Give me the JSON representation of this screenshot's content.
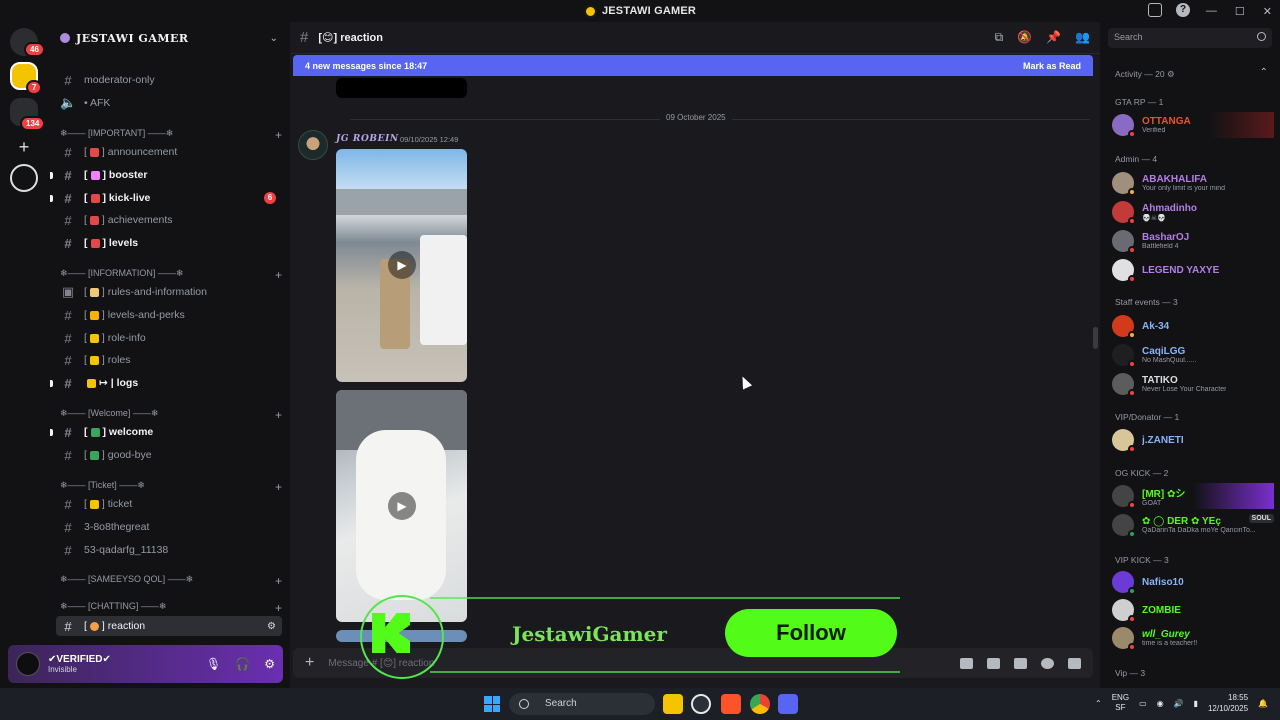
{
  "titlebar": {
    "title": "JESTAWI GAMER",
    "min": "—",
    "max": "☐",
    "close": "✕"
  },
  "rail": {
    "dm_badge": "46",
    "server_badge": "7",
    "folder_badge": "134"
  },
  "sidebar": {
    "guild_name": "JESTAWI GAMER",
    "channels_top": [
      {
        "label": "moderator-only"
      },
      {
        "label": "• AFK"
      }
    ],
    "categories": {
      "important": "❄—— [IMPORTANT] ——❄",
      "information": "❄—— [INFORMATION] ——❄",
      "welcome": "❄—— [Welcome] ——❄",
      "ticket": "❄—— [Ticket] ——❄",
      "sameeyso": "❄—— [SAMEEYSO QOL] ——❄",
      "chatting": "❄—— [CHATTING] ——❄"
    },
    "channels": {
      "announcement": "announcement",
      "booster": "booster",
      "kick_live": "kick-live",
      "kick_live_mentions": "6",
      "achievements": "achievements",
      "levels": "levels",
      "rules": "rules-and-information",
      "levels_perks": "levels-and-perks",
      "role_info": "role-info",
      "roles": "roles",
      "logs": "logs",
      "welcome": "welcome",
      "goodbye": "good-bye",
      "ticket": "ticket",
      "t1": "3-8o8thegreat",
      "t2": "53-qadarfg_11138",
      "reaction": "reaction"
    }
  },
  "user": {
    "name": "✔VERIFIED✔",
    "status": "Invisible"
  },
  "channel": {
    "name": "reaction",
    "new_messages": "4 new messages since 18:47",
    "mark_read": "Mark as Read",
    "date_divider": "09 October 2025",
    "message": {
      "author": "JG ROBEIN",
      "time": "09/10/2025 12:49"
    },
    "composer_placeholder": "Message # [😊] reaction"
  },
  "overlay": {
    "name": "JestawiGamer",
    "follow": "Follow"
  },
  "members": {
    "search_placeholder": "Search",
    "groups": [
      {
        "header": "Activity — 20"
      },
      {
        "header": "GTA RP — 1"
      },
      {
        "header": "Admin — 4"
      },
      {
        "header": "Staff events — 3"
      },
      {
        "header": "VIP/Donator — 1"
      },
      {
        "header": "OG KICK — 2"
      },
      {
        "header": "VIP KICK — 3"
      },
      {
        "header": "Vip — 3"
      }
    ],
    "list": [
      {
        "name": "OTTANGA",
        "sub": "Verified",
        "color": "#e8552b"
      },
      {
        "name": "ABAKHALIFA",
        "sub": "Your only limit is your mind",
        "color": "#b47ee6"
      },
      {
        "name": "Ahmadinho",
        "sub": "💀☠💀",
        "color": "#b47ee6"
      },
      {
        "name": "BasharOJ",
        "sub": "Battlefield 4",
        "color": "#b47ee6"
      },
      {
        "name": "LEGEND YAXYE",
        "sub": "",
        "color": "#b47ee6"
      },
      {
        "name": "Ak-34",
        "sub": "",
        "color": "#8ab4f8"
      },
      {
        "name": "CaqiLGG",
        "sub": "No MashQuul......",
        "color": "#8ab4f8"
      },
      {
        "name": "TATIKO",
        "sub": "Never Lose Your Character",
        "color": "#dbdee1"
      },
      {
        "name": "j.ZANETI",
        "sub": "",
        "color": "#8ab4f8"
      },
      {
        "name": "[MR] ✿シ",
        "sub": "GOAT",
        "color": "#53fc18"
      },
      {
        "name": "✿ ◯ DER ✿ YEç",
        "sub": "QaDarinTa DaDka moYe QancinTo...",
        "color": "#53fc18"
      },
      {
        "name": "Nafiso10",
        "sub": "",
        "color": "#8ab4f8"
      },
      {
        "name": "ZOMBIE",
        "sub": "",
        "color": "#53fc18"
      },
      {
        "name": "wll_Gurey",
        "sub": "time is a teacher!!",
        "color": "#53fc18"
      }
    ],
    "soul_tag": "SOUL"
  },
  "taskbar": {
    "search": "Search",
    "lang": "ENG",
    "region": "SF",
    "time": "18:55",
    "date": "12/10/2025"
  },
  "colors": {
    "accent": "#5865f2",
    "kick": "#53fc18",
    "bg": "#1a1a1e",
    "sidebar": "#121214"
  }
}
